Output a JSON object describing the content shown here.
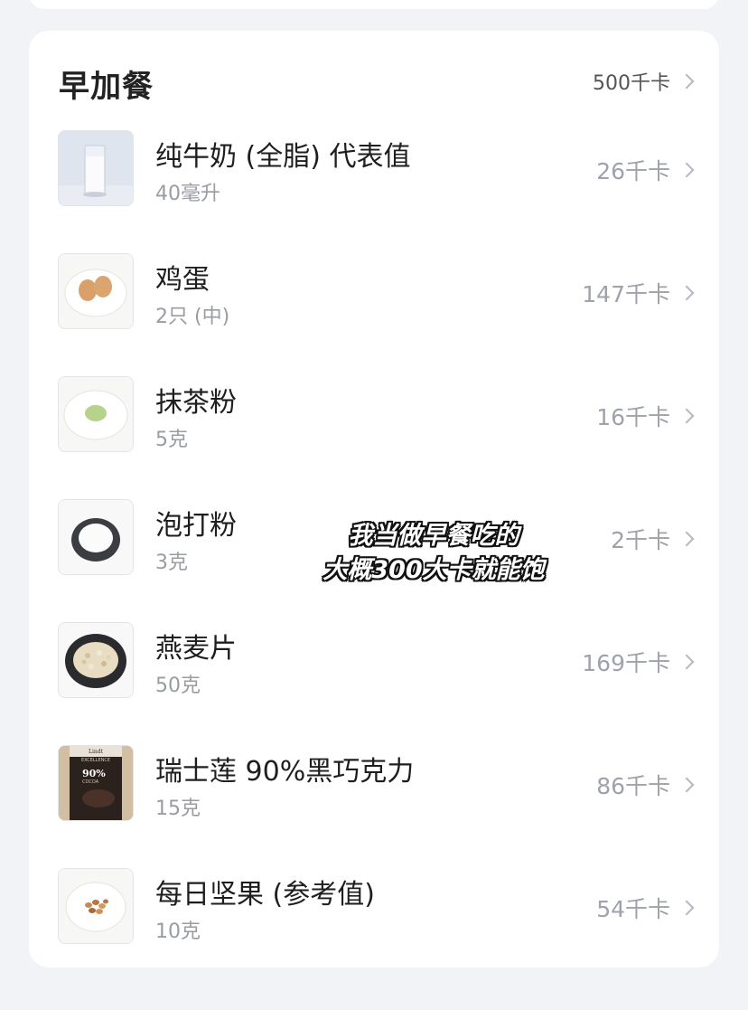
{
  "section": {
    "title": "早加餐",
    "total_kcal": "500千卡"
  },
  "items": [
    {
      "name": "纯牛奶 (全脂) 代表值",
      "amount": "40毫升",
      "kcal": "26千卡",
      "icon": "milk-glass"
    },
    {
      "name": "鸡蛋",
      "amount": "2只 (中)",
      "kcal": "147千卡",
      "icon": "eggs"
    },
    {
      "name": "抹茶粉",
      "amount": "5克",
      "kcal": "16千卡",
      "icon": "matcha-powder"
    },
    {
      "name": "泡打粉",
      "amount": "3克",
      "kcal": "2千卡",
      "icon": "baking-powder-bowl"
    },
    {
      "name": "燕麦片",
      "amount": "50克",
      "kcal": "169千卡",
      "icon": "oatmeal-bowl"
    },
    {
      "name": "瑞士莲 90%黑巧克力",
      "amount": "15克",
      "kcal": "86千卡",
      "icon": "chocolate-bar",
      "package_text": {
        "brand": "Lindt",
        "line": "EXCELLENCE",
        "percent": "90%",
        "cocoa": "COCOA"
      }
    },
    {
      "name": "每日坚果 (参考值)",
      "amount": "10克",
      "kcal": "54千卡",
      "icon": "mixed-nuts"
    }
  ],
  "overlay_caption": [
    "我当做早餐吃的",
    "大概300大卡就能饱"
  ],
  "colors": {
    "background": "#f2f3f7",
    "card": "#ffffff",
    "text_primary": "#1e1e1e",
    "text_secondary": "#9a9ca3"
  }
}
